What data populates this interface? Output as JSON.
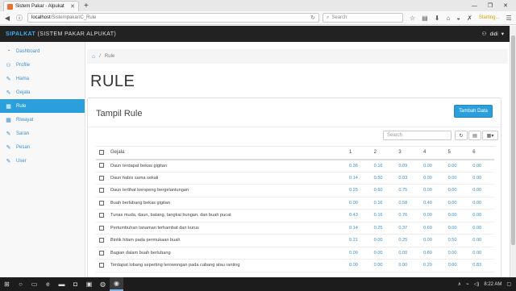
{
  "browser": {
    "tab_title": "Sistem Pakar - Alpukat",
    "new_tab": "+",
    "url_host": "localhost",
    "url_path": "/Sistempakar/C_Rule",
    "search_placeholder": "Search",
    "startpage_label": "Starting..."
  },
  "app": {
    "brand_accent": "SIPALKAT",
    "brand_rest": " (SISTEM PAKAR ALPUKAT)",
    "user": "didi",
    "accent_color": "#2a9fdb"
  },
  "sidebar": {
    "items": [
      {
        "label": "Dashboard",
        "icon": "dashboard-icon"
      },
      {
        "label": "Profile",
        "icon": "user-icon"
      },
      {
        "label": "Hama",
        "icon": "pencil-icon"
      },
      {
        "label": "Gejala",
        "icon": "pencil-icon"
      },
      {
        "label": "Rule",
        "icon": "table-icon"
      },
      {
        "label": "Riwayat",
        "icon": "table-icon"
      },
      {
        "label": "Saran",
        "icon": "pencil-icon"
      },
      {
        "label": "Pesan",
        "icon": "pencil-icon"
      },
      {
        "label": "User",
        "icon": "pencil-icon"
      }
    ]
  },
  "breadcrumb": {
    "current": "Rule"
  },
  "page": {
    "title": "RULE"
  },
  "panel": {
    "title": "Tampil Rule",
    "add_button": "Tambah Data",
    "search_placeholder": "Search"
  },
  "table": {
    "headers": [
      "Gejala",
      "1",
      "2",
      "3",
      "4",
      "5",
      "6"
    ],
    "rows": [
      [
        "Daun terdapat bekas gigitan",
        "0.36",
        "0.16",
        "0.09",
        "0.00",
        "0.00",
        "0.00"
      ],
      [
        "Daun habis sama sekali",
        "0.14",
        "0.50",
        "0.03",
        "0.00",
        "0.00",
        "0.00"
      ],
      [
        "Daun terlihat keropeng bergelantungan",
        "0.25",
        "0.60",
        "0.75",
        "0.00",
        "0.00",
        "0.00"
      ],
      [
        "Buah berlubang bekas gigitan",
        "0.00",
        "0.16",
        "0.58",
        "0.40",
        "0.00",
        "0.00"
      ],
      [
        "Tunas muda, daun, batang, tangkai bungan, dan buah pucat",
        "0.43",
        "0.16",
        "0.76",
        "0.00",
        "0.00",
        "0.00"
      ],
      [
        "Pertumbuhan tanaman terhambat dan kurus",
        "0.14",
        "0.25",
        "0.37",
        "0.60",
        "0.00",
        "0.00"
      ],
      [
        "Bintik hitam pada permukaan buah",
        "0.21",
        "0.00",
        "0.25",
        "0.00",
        "0.50",
        "0.00"
      ],
      [
        "Bagian dalam buah berlubang",
        "0.00",
        "0.00",
        "0.00",
        "0.80",
        "0.00",
        "0.00"
      ],
      [
        "Terdapat lobang seperting terowongan pada cabang atau ranting",
        "0.00",
        "0.00",
        "0.00",
        "0.20",
        "0.00",
        "0.83"
      ]
    ]
  },
  "taskbar": {
    "time": "8:22 AM"
  }
}
